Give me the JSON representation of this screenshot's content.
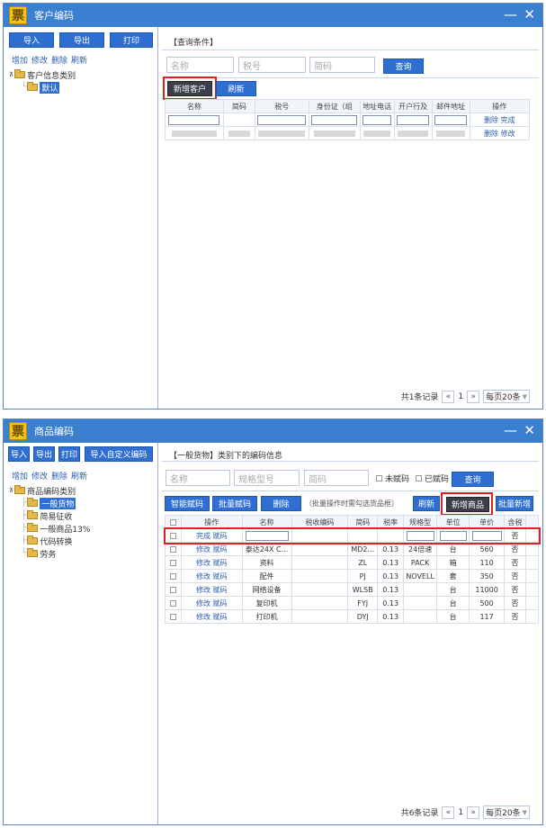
{
  "top": {
    "title": "客户编码",
    "logo": "票",
    "minimize": "—",
    "close": "✕",
    "toolbar": {
      "import": "导入",
      "export": "导出",
      "print": "打印"
    },
    "links": {
      "add": "增加",
      "edit": "修改",
      "delete": "删除",
      "refresh": "刷新"
    },
    "tree": {
      "root": "客户信息类别",
      "child": "默认"
    },
    "section_title": "【查询条件】",
    "search": {
      "name_ph": "名称",
      "tax_ph": "税号",
      "code_ph": "简码",
      "query": "查询"
    },
    "buttons": {
      "new_customer": "新增客户",
      "refresh": "刷新"
    },
    "columns": [
      "名称",
      "简码",
      "税号",
      "身份证（组",
      "地址电话",
      "开户行及",
      "邮件地址",
      "操作"
    ],
    "row1_actions": {
      "delete": "删除",
      "done": "完成"
    },
    "row2_actions": {
      "delete": "删除",
      "edit": "修改"
    },
    "pager": {
      "total": "共1条记录",
      "prev": "«",
      "page": "1",
      "next": "»",
      "per_page": "每页20条"
    }
  },
  "bottom": {
    "title": "商品编码",
    "logo": "票",
    "minimize": "—",
    "close": "✕",
    "toolbar": {
      "import": "导入",
      "export": "导出",
      "print": "打印",
      "import_custom": "导入自定义编码"
    },
    "links": {
      "add": "增加",
      "edit": "修改",
      "delete": "删除",
      "refresh": "刷新"
    },
    "tree": {
      "root": "商品编码类别",
      "items": [
        "一般货物",
        "简易征收",
        "一般商品13%",
        "代码转换",
        "劳务"
      ]
    },
    "section_title": "【一般货物】类别下的编码信息",
    "search": {
      "name_ph": "名称",
      "spec_ph": "规格型号",
      "code_ph": "简码",
      "unassigned": "未赋码",
      "assigned": "已赋码",
      "query": "查询"
    },
    "buttons": {
      "smart_code": "智能赋码",
      "batch_code": "批量赋码",
      "delete": "删除",
      "batch_hint": "（批量操作时需勾选货品框）",
      "refresh": "刷新",
      "new_goods": "新增商品",
      "batch_new": "批量新增"
    },
    "columns": [
      "",
      "操作",
      "名称",
      "税收编码",
      "简码",
      "税率",
      "规格型",
      "单位",
      "单价",
      "含税"
    ],
    "new_row": {
      "done": "完成",
      "code": "赋码",
      "tax": "否"
    },
    "rows": [
      {
        "name": "泰达24X C...",
        "code": "MD2...",
        "rate": "0.13",
        "spec": "24倍速",
        "unit": "台",
        "price": "560",
        "tax": "否"
      },
      {
        "name": "资料",
        "code": "ZL",
        "rate": "0.13",
        "spec": "PACK",
        "unit": "箱",
        "price": "110",
        "tax": "否"
      },
      {
        "name": "配件",
        "code": "PJ",
        "rate": "0.13",
        "spec": "NOVELL",
        "unit": "套",
        "price": "350",
        "tax": "否"
      },
      {
        "name": "网络设备",
        "code": "WLSB",
        "rate": "0.13",
        "spec": "",
        "unit": "台",
        "price": "11000",
        "tax": "否"
      },
      {
        "name": "复印机",
        "code": "FYJ",
        "rate": "0.13",
        "spec": "",
        "unit": "台",
        "price": "500",
        "tax": "否"
      },
      {
        "name": "打印机",
        "code": "DYJ",
        "rate": "0.13",
        "spec": "",
        "unit": "台",
        "price": "117",
        "tax": "否"
      }
    ],
    "row_actions": {
      "edit": "修改",
      "code": "赋码"
    },
    "pager": {
      "total": "共6条记录",
      "prev": "«",
      "page": "1",
      "next": "»",
      "per_page": "每页20条"
    }
  }
}
